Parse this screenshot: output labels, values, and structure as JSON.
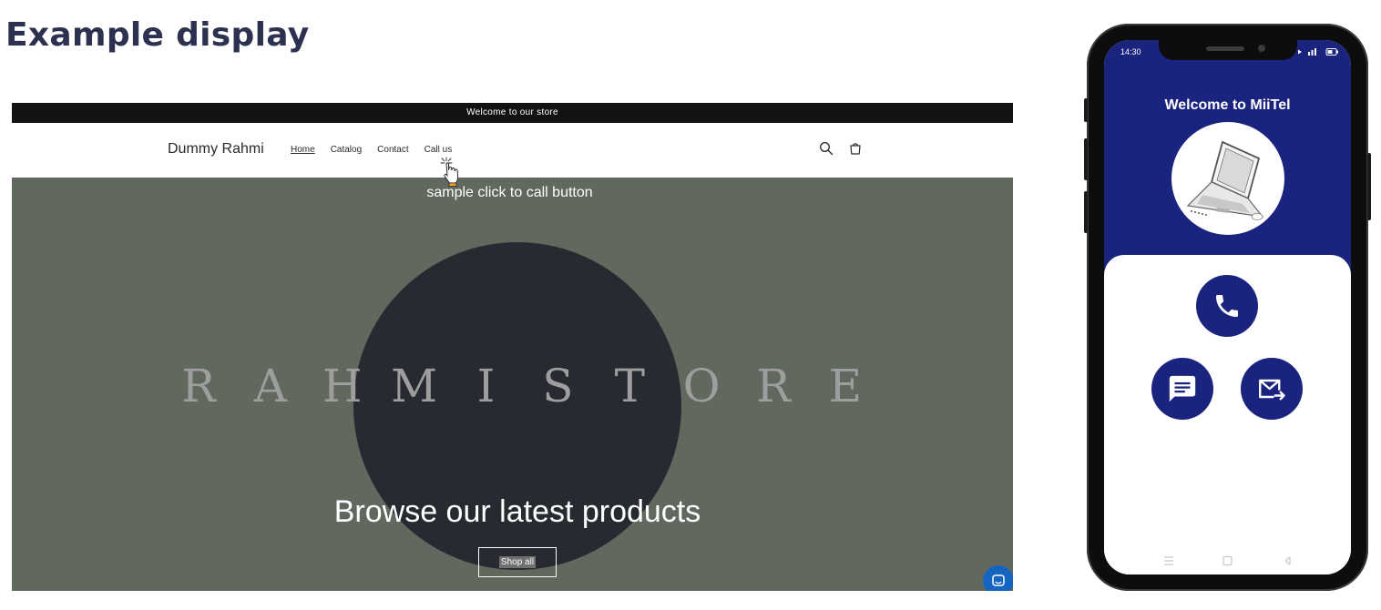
{
  "page": {
    "heading": "Example display"
  },
  "store": {
    "announcement": "Welcome to our store",
    "name": "Dummy Rahmi",
    "nav": [
      {
        "label": "Home"
      },
      {
        "label": "Catalog"
      },
      {
        "label": "Contact"
      },
      {
        "label": "Call us"
      }
    ],
    "active_nav": "Home",
    "callout": "sample click to call button",
    "brand_letters": [
      "R",
      "A",
      "H",
      "M",
      "I",
      "S",
      "T",
      "O",
      "R",
      "E"
    ],
    "hero_title": "Browse our latest products",
    "shop_button": "Shop all",
    "icons": [
      "search-icon",
      "cart-icon",
      "hand-pointer-icon",
      "chat-icon"
    ]
  },
  "phone": {
    "status_time": "14:30",
    "welcome": "Welcome to MiiTel",
    "buttons": [
      "phone-icon",
      "message-icon",
      "mail-forward-icon"
    ]
  },
  "colors": {
    "heading": "#2d3150",
    "announcement_bg": "#121212",
    "hero_bg": "#61685d",
    "hero_circle": "#282a31",
    "phone_accent": "#1a237e",
    "chat_bubble": "#1565c0"
  }
}
